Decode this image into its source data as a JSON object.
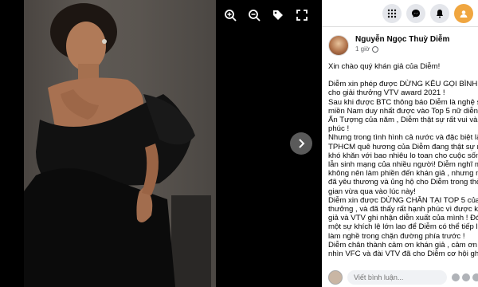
{
  "viewer": {
    "tools": [
      {
        "name": "zoom-in-icon"
      },
      {
        "name": "zoom-out-icon"
      },
      {
        "name": "tag-icon"
      },
      {
        "name": "fullscreen-icon"
      }
    ],
    "next_icon": "chevron-right-icon"
  },
  "header": {
    "icons": [
      "menu-grid-icon",
      "messenger-icon",
      "notifications-icon",
      "profile-avatar-icon"
    ]
  },
  "post": {
    "author": "Nguyễn Ngọc Thuỳ Diễm",
    "time": "1 giờ",
    "lines": [
      "Xin chào quý khán giả của Diễm!",
      "",
      "Diễm xin phép được DỪNG KÊU GỌI BÌNH CHỌ",
      "cho giải thưởng VTV award 2021 !",
      "Sau khi được BTC thông báo Diễm là nghệ sĩ",
      "miền Nam duy nhất được vào Top 5 nữ diễn viê",
      "Ấn Tượng của năm , Diễm thật sự rất vui và han",
      "phúc !",
      "Nhưng trong tình hình cả nước và đặc biệt là",
      "TPHCM quê hương của Diễm đang thật sự rất",
      "khó khăn với bao nhiêu lo toan cho cuộc sống",
      "lẫn sinh mạng của nhiều người! Diễm nghĩ min",
      "không nên làm phiền đến khán giả , nhưng ngư",
      "đã yêu thương và ủng hộ cho Diễm trong thời",
      "gian vừa qua vào lúc này!",
      "Diễm xin được DỪNG CHÂN TẠI TOP 5 của giải",
      "thưởng , và đã thấy rất hạnh phúc vì được khán",
      "giả và VTV ghi nhận diễn xuất của mình ! Đó là",
      "một sự khích lệ lớn lao để Diễm có thể tiếp lửa",
      "làm nghề trong chặn đường phía trước !",
      "Diễm chân thành cảm ơn khán giả , cảm ơn hả",
      "nhìn VFC và đài VTV đã cho Diễm cơ hội ghi d"
    ]
  },
  "comment": {
    "placeholder": "Viết bình luận..."
  }
}
